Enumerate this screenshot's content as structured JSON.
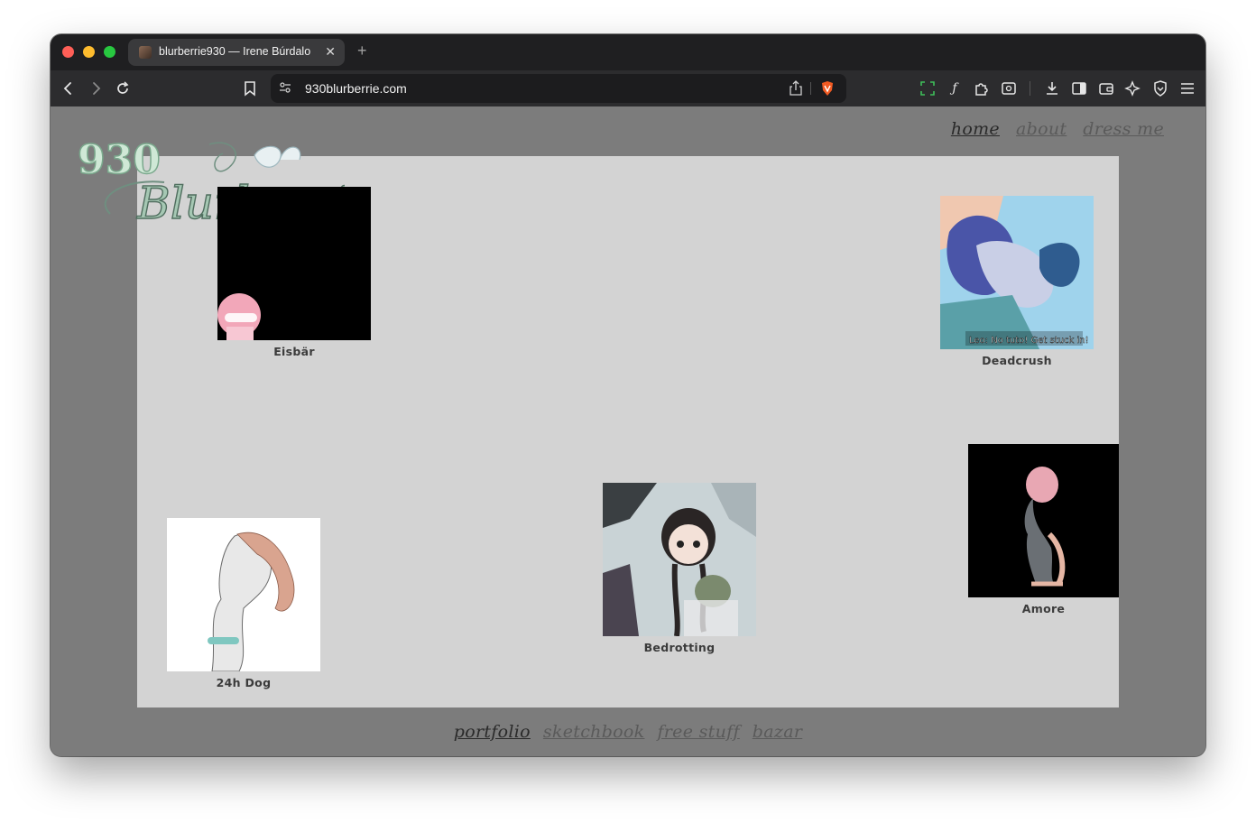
{
  "browser": {
    "tab": {
      "title": "blurberrie930 — Irene Búrdalo",
      "close": "✕"
    },
    "new_tab": "+",
    "url": "930blurberrie.com",
    "toolbar_icons": [
      "back-icon",
      "forward-icon",
      "reload-icon",
      "bookmark-icon",
      "site-settings-icon",
      "share-icon",
      "brave-shield-icon",
      "screenshot-icon",
      "fx-icon",
      "extensions-icon",
      "reader-icon",
      "downloads-icon",
      "sidebar-icon",
      "wallet-icon",
      "leo-ai-icon",
      "vpn-icon",
      "menu-icon"
    ]
  },
  "site": {
    "logo_text": "930 Blurberrie",
    "nav_top": [
      {
        "label": "home",
        "active": true
      },
      {
        "label": "about",
        "active": false
      },
      {
        "label": "dress me",
        "active": false
      }
    ],
    "nav_bottom": [
      {
        "label": "portfolio",
        "active": true
      },
      {
        "label": "sketchbook",
        "active": false
      },
      {
        "label": "free stuff",
        "active": false
      },
      {
        "label": "bazar",
        "active": false
      }
    ],
    "gallery": [
      {
        "label": "Eisbär",
        "thumb": "black-with-pink-character"
      },
      {
        "label": "Deadcrush",
        "thumb": "blue-illustration",
        "caption": "Leo: No tuto! Get stuck in!"
      },
      {
        "label": "24h Dog",
        "thumb": "sketch-figure"
      },
      {
        "label": "Bedrotting",
        "thumb": "anime-girl-on-bed"
      },
      {
        "label": "Amore",
        "thumb": "black-with-pink-figure"
      }
    ]
  }
}
